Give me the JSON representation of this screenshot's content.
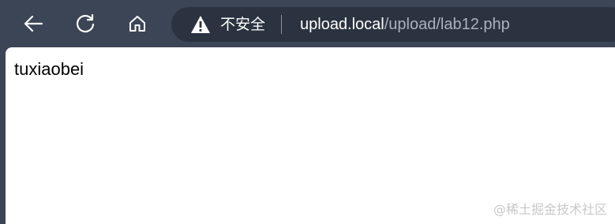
{
  "toolbar": {
    "back_icon": "back-arrow-icon",
    "reload_icon": "reload-icon",
    "home_icon": "home-icon"
  },
  "address_bar": {
    "security_icon": "warning-icon",
    "security_label": "不安全",
    "url_host": "upload.local",
    "url_path": "/upload/lab12.php"
  },
  "page": {
    "body_text": "tuxiaobei"
  },
  "watermark": {
    "text": "@稀土掘金技术社区"
  },
  "colors": {
    "toolbar_bg": "#3b4556",
    "address_bar_bg": "#2b3340",
    "url_host": "#ffffff",
    "url_path": "#aab2bf",
    "page_bg": "#ffffff"
  }
}
